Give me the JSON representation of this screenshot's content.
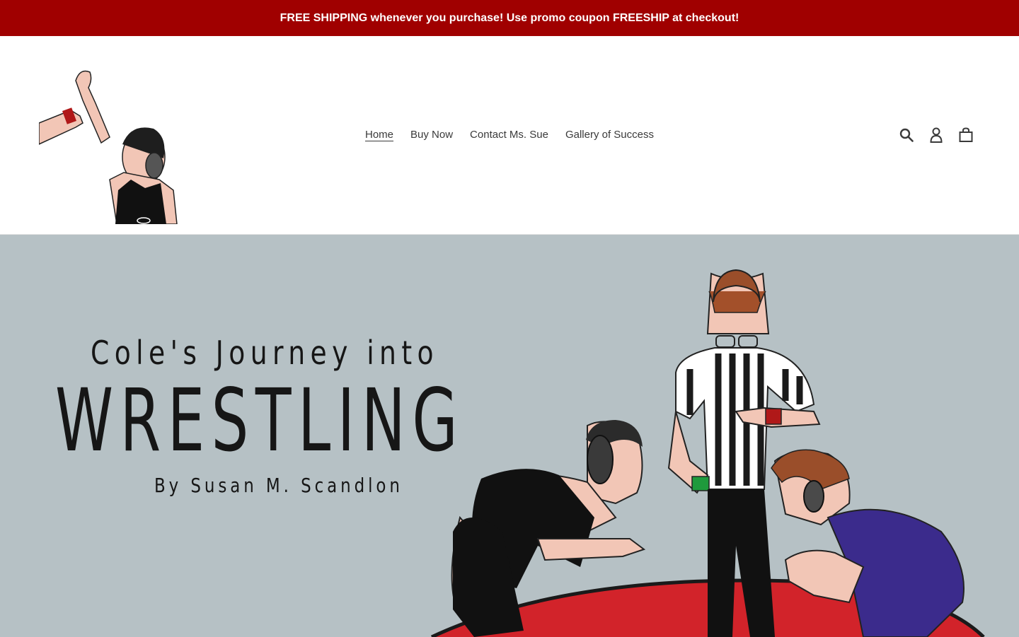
{
  "announcement": "FREE SHIPPING whenever you purchase! Use promo coupon FREESHIP at checkout!",
  "colors": {
    "announcement_bg": "#a00000",
    "hero_bg": "#b6c1c5",
    "mat_red": "#d2232a"
  },
  "nav": {
    "items": [
      {
        "label": "Home",
        "active": true
      },
      {
        "label": "Buy Now",
        "active": false
      },
      {
        "label": "Contact Ms. Sue",
        "active": false
      },
      {
        "label": "Gallery of Success",
        "active": false
      }
    ]
  },
  "header_icons": [
    "search-icon",
    "account-icon",
    "cart-icon"
  ],
  "hero": {
    "title_line1": "Cole's Journey into",
    "title_line2": "WRESTLING",
    "byline": "By Susan M. Scandlon"
  }
}
